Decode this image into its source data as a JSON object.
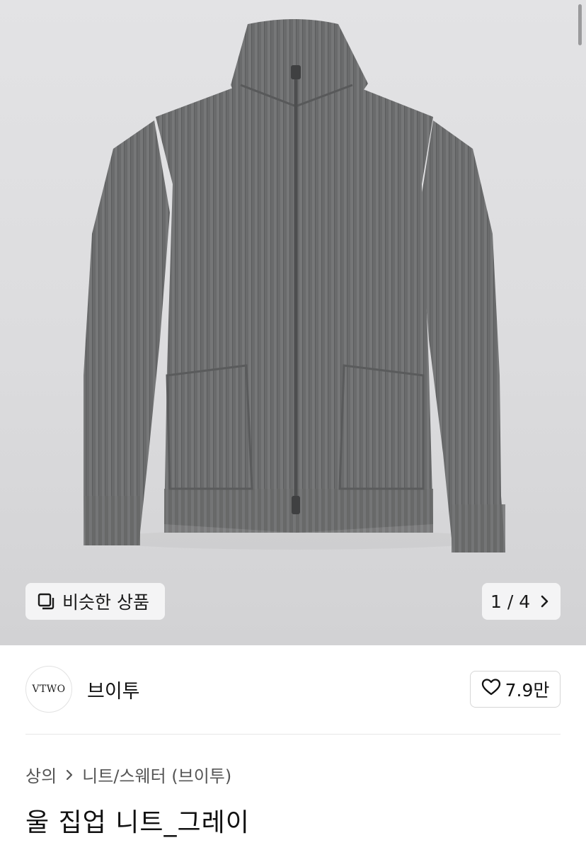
{
  "gallery": {
    "image_alt": "Gray ribbed wool zip-up knit jacket",
    "similar_button_label": "비슷한 상품",
    "counter_label": "1 / 4"
  },
  "seller": {
    "logo_text": "VTWO",
    "name": "브이투",
    "likes": "7.9만"
  },
  "breadcrumb": {
    "category": "상의",
    "subcategory": "니트/스웨터 (브이투)"
  },
  "product": {
    "title": "울 집업 니트_그레이"
  },
  "colors": {
    "sweater": "#6b6c6d",
    "background": "#dcdcde"
  }
}
